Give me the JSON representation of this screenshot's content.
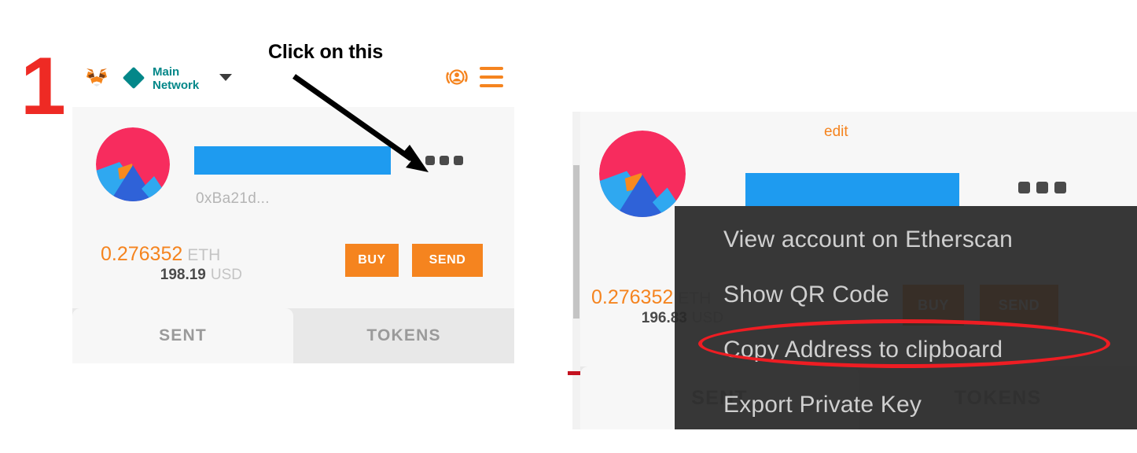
{
  "annotation": {
    "step_number": "1",
    "callout_text": "Click on this",
    "highlight_color": "#ee1d23",
    "step_color": "#EE2A24"
  },
  "panel_left": {
    "name": "metamask-wallet-main-view",
    "header": {
      "logo_icon": "metamask-fox-icon",
      "network_icon": "network-diamond-icon",
      "network_label": "Main\nNetwork",
      "network_label_line1": "Main",
      "network_label_line2": "Network",
      "network_caret_icon": "chevron-down-icon",
      "switch_account_icon": "switch-account-icon",
      "menu_icon": "hamburger-menu-icon",
      "accent_color": "#038789",
      "icon_color": "#f5841f"
    },
    "account": {
      "identicon": "account-identicon",
      "account_name_redacted": "",
      "address_short": "0xBa21d...",
      "more_options_icon": "three-dots-icon"
    },
    "balance": {
      "eth_amount": "0.276352",
      "eth_unit": "ETH",
      "fiat_amount": "198.19",
      "fiat_unit": "USD",
      "amount_color": "#f5841f"
    },
    "actions": {
      "buy_label": "BUY",
      "send_label": "SEND",
      "button_color": "#f5841f"
    },
    "tabs": [
      {
        "label": "SENT",
        "active": true
      },
      {
        "label": "TOKENS",
        "active": false
      }
    ]
  },
  "panel_right": {
    "name": "metamask-account-options-menu",
    "edit_label": "edit",
    "identicon": "account-identicon",
    "account_name_redacted": "",
    "more_options_icon": "three-dots-icon",
    "balance": {
      "eth_amount": "0.276352",
      "eth_unit": "ETH",
      "fiat_amount": "196.83",
      "fiat_unit": "USD"
    },
    "actions": {
      "buy_label": "BUY",
      "send_label": "SEND"
    },
    "tabs": [
      {
        "label": "SENT",
        "active": true
      },
      {
        "label": "TOKENS",
        "active": false
      }
    ],
    "dropdown_menu": {
      "items": [
        {
          "label": "View account on Etherscan",
          "highlighted": false
        },
        {
          "label": "Show QR Code",
          "highlighted": false
        },
        {
          "label": "Copy Address to clipboard",
          "highlighted": true
        },
        {
          "label": "Export Private Key",
          "highlighted": false
        }
      ]
    }
  }
}
